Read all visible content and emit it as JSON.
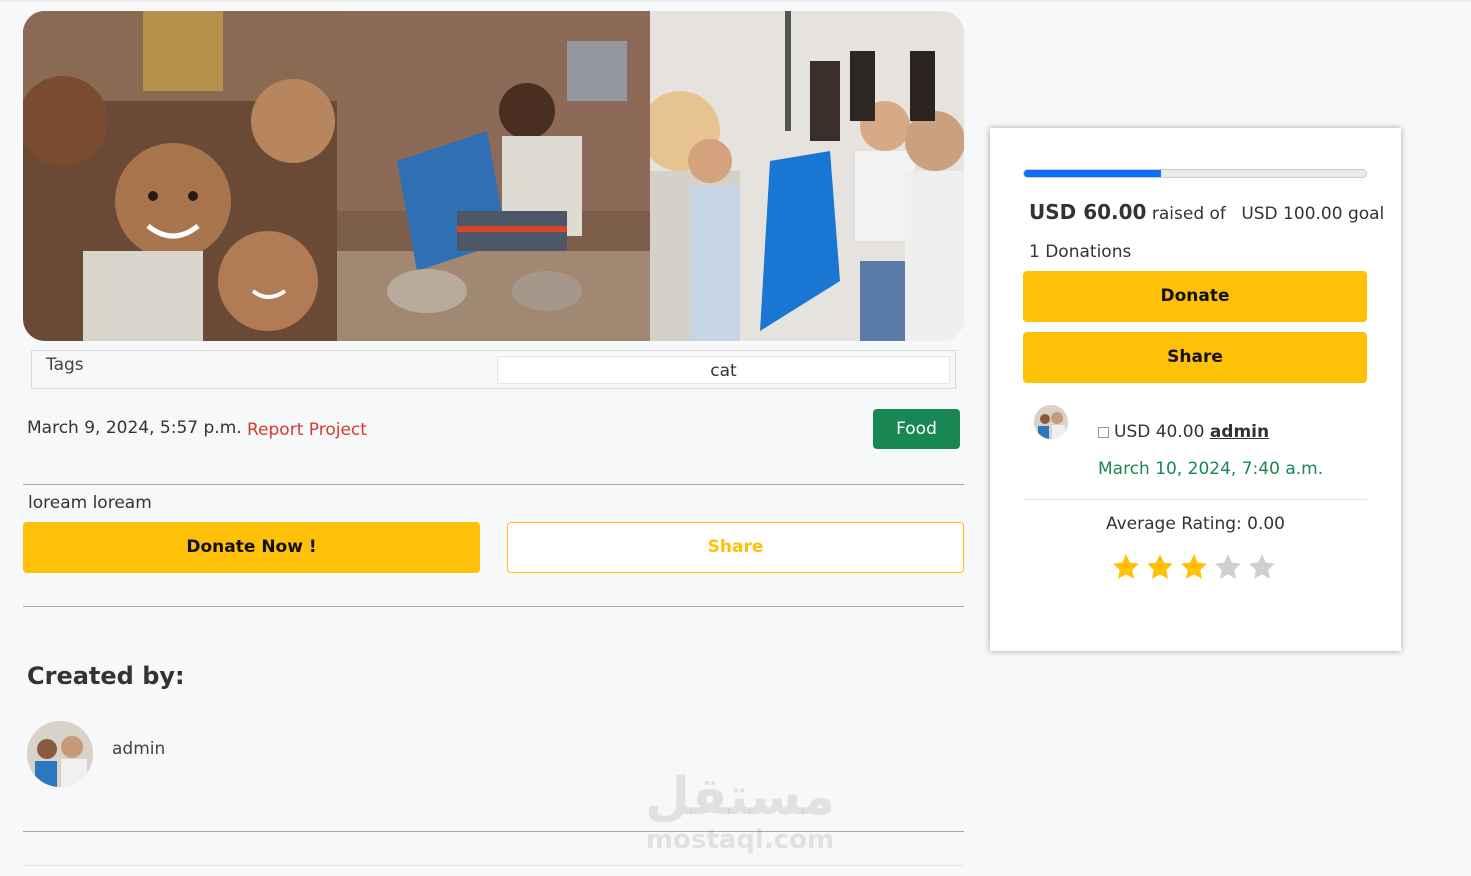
{
  "project": {
    "images": [
      {
        "name": "children-smiling-photo"
      },
      {
        "name": "child-sitting-with-bag-photo"
      },
      {
        "name": "volunteers-distributing-aid-photo"
      }
    ],
    "tags_label": "Tags",
    "tags": [
      "cat"
    ],
    "date": "March 9, 2024, 5:57 p.m.",
    "report_label": "Report Project",
    "category": "Food",
    "description": "loream loream",
    "donate_now_label": "Donate Now !",
    "share_label": "Share",
    "created_by_title": "Created by:",
    "creator_name": "admin"
  },
  "watermark": {
    "arabic": "مستقل",
    "latin": "mostaql.com"
  },
  "sidebar": {
    "progress_fraction": 0.4,
    "raised_amount": "USD 60.00",
    "raised_of": "raised of",
    "goal": "USD 100.00 goal",
    "donations_count": "1 Donations",
    "donate_label": "Donate",
    "share_label": "Share",
    "recent_donation": {
      "amount": "USD 40.00",
      "donor": "admin",
      "date": "March 10, 2024, 7:40 a.m."
    },
    "average_rating_label": "Average Rating: 0.00",
    "stars_filled": 3,
    "stars_total": 5,
    "colors": {
      "accent": "#ffc107",
      "progress": "#0d6efd",
      "success": "#198754",
      "danger": "#d63a2f",
      "star_on": "#ffc107",
      "star_off": "#cfcfcf"
    }
  }
}
